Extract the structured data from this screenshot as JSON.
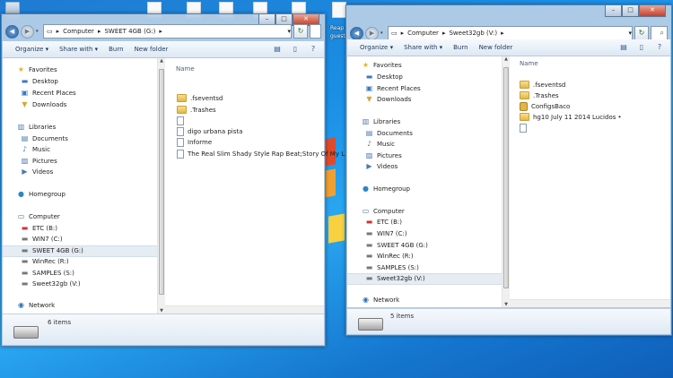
{
  "desktop": {
    "label_left": "Reap",
    "label_left2": "guest"
  },
  "window_left": {
    "breadcrumb": [
      "Computer",
      "SWEET 4GB (G:)"
    ],
    "toolbar": {
      "organize": "Organize ▾",
      "share": "Share with ▾",
      "burn": "Burn",
      "new_folder": "New folder"
    },
    "nav": {
      "favorites": {
        "header": "Favorites",
        "items": [
          "Desktop",
          "Recent Places",
          "Downloads"
        ]
      },
      "libraries": {
        "header": "Libraries",
        "items": [
          "Documents",
          "Music",
          "Pictures",
          "Videos"
        ]
      },
      "homegroup": "Homegroup",
      "computer": {
        "header": "Computer",
        "items": [
          "ETC (B:)",
          "WIN7 (C:)",
          "SWEET 4GB (G:)",
          "WinRec (R:)",
          "SAMPLES (S:)",
          "Sweet32gb (V:)"
        ],
        "selected": 2
      },
      "network": "Network"
    },
    "column_header": "Name",
    "files": [
      {
        "name": ".fseventsd",
        "type": "folder"
      },
      {
        "name": ".Trashes",
        "type": "folder"
      },
      {
        "name": "",
        "type": "doc"
      },
      {
        "name": "digo urbana pista",
        "type": "doc"
      },
      {
        "name": "Informe",
        "type": "doc"
      },
      {
        "name": "The Real Slim Shady Style Rap Beat;Story Of My L",
        "type": "doc"
      }
    ],
    "status_count": "6 items"
  },
  "window_right": {
    "breadcrumb": [
      "Computer",
      "Sweet32gb (V:)"
    ],
    "toolbar": {
      "organize": "Organize ▾",
      "share": "Share with ▾",
      "burn": "Burn",
      "new_folder": "New folder"
    },
    "nav": {
      "favorites": {
        "header": "Favorites",
        "items": [
          "Desktop",
          "Recent Places",
          "Downloads"
        ]
      },
      "libraries": {
        "header": "Libraries",
        "items": [
          "Documents",
          "Music",
          "Pictures",
          "Videos"
        ]
      },
      "homegroup": "Homegroup",
      "computer": {
        "header": "Computer",
        "items": [
          "ETC (B:)",
          "WIN7 (C:)",
          "SWEET 4GB (G:)",
          "WinRec (R:)",
          "SAMPLES (S:)",
          "Sweet32gb (V:)"
        ],
        "selected": 5
      },
      "network": "Network"
    },
    "column_header": "Name",
    "files": [
      {
        "name": ".fseventsd",
        "type": "folder"
      },
      {
        "name": ".Trashes",
        "type": "folder"
      },
      {
        "name": "ConfigsBaco",
        "type": "lock"
      },
      {
        "name": "hg10 July 11 2014 Lucidos ‣",
        "type": "folder"
      },
      {
        "name": "",
        "type": "doc"
      }
    ],
    "status_count": "5 items"
  },
  "window_controls": {
    "minimize": "–",
    "maximize": "□",
    "close": "✕"
  },
  "colors": {
    "desktop_blue": "#1a8fe6",
    "selection": "#e5ecf3",
    "toolbar_text": "#1e395b"
  }
}
